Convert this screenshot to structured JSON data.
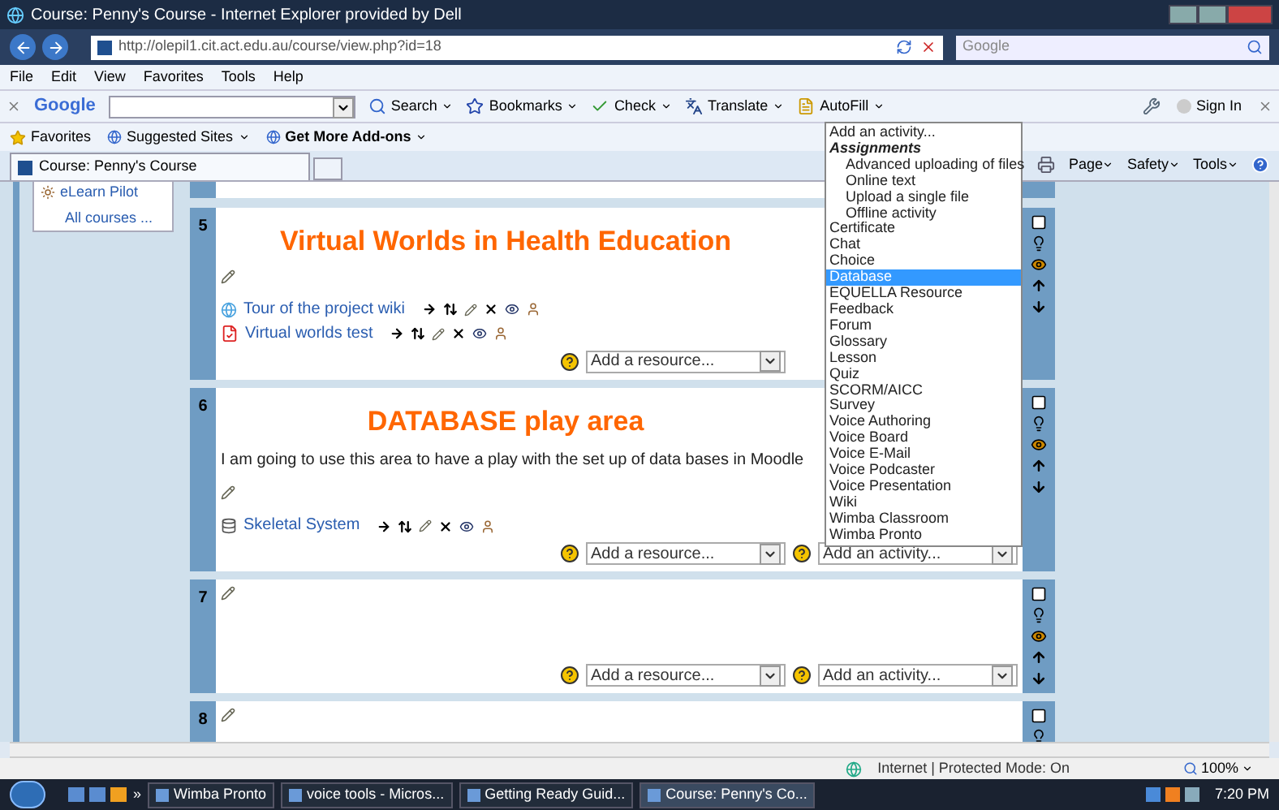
{
  "window": {
    "title": "Course: Penny's Course - Internet Explorer provided by Dell"
  },
  "address_bar": {
    "url": "http://olepil1.cit.act.edu.au/course/view.php?id=18",
    "search_placeholder": "Google"
  },
  "menu": [
    "File",
    "Edit",
    "View",
    "Favorites",
    "Tools",
    "Help"
  ],
  "google_toolbar": {
    "brand": "Google",
    "buttons": [
      {
        "label": "Search",
        "kind": "search"
      },
      {
        "label": "Bookmarks",
        "kind": "star"
      },
      {
        "label": "Check",
        "kind": "check"
      },
      {
        "label": "Translate",
        "kind": "translate"
      },
      {
        "label": "AutoFill",
        "kind": "autofill"
      }
    ],
    "sign_in": "Sign In"
  },
  "favorites_bar": {
    "favorites": "Favorites",
    "links": [
      {
        "label": "Suggested Sites",
        "bold": false
      },
      {
        "label": "Get More Add-ons",
        "bold": true
      }
    ]
  },
  "tabs": [
    {
      "label": "Course: Penny's Course",
      "selected": true
    }
  ],
  "command_bar": [
    "Page",
    "Safety",
    "Tools"
  ],
  "sidebar": {
    "course": "eLearn Pilot",
    "all_courses": "All courses ..."
  },
  "sections": [
    {
      "number": "5",
      "title": "Virtual Worlds in Health Education",
      "activities": [
        {
          "name": "Tour of the project wiki",
          "kind": "wiki"
        },
        {
          "name": "Virtual worlds test",
          "kind": "quiz"
        }
      ],
      "add_resource": "Add a resource..."
    },
    {
      "number": "6",
      "title": "DATABASE play area",
      "summary": "I am going to use this area to have a play with the set up of data bases in Moodle",
      "activities": [
        {
          "name": "Skeletal System",
          "kind": "database"
        }
      ],
      "add_resource": "Add a resource...",
      "add_activity": "Add an activity..."
    },
    {
      "number": "7",
      "add_resource": "Add a resource...",
      "add_activity": "Add an activity..."
    },
    {
      "number": "8"
    }
  ],
  "activity_dropdown": {
    "options": [
      {
        "label": "Add an activity...",
        "kind": "option",
        "selected": false
      },
      {
        "label": "Assignments",
        "kind": "group",
        "selected": false
      },
      {
        "label": "Advanced uploading of files",
        "kind": "suboption",
        "selected": false
      },
      {
        "label": "Online text",
        "kind": "suboption",
        "selected": false
      },
      {
        "label": "Upload a single file",
        "kind": "suboption",
        "selected": false
      },
      {
        "label": "Offline activity",
        "kind": "suboption",
        "selected": false
      },
      {
        "label": "Certificate",
        "kind": "option",
        "selected": false
      },
      {
        "label": "Chat",
        "kind": "option",
        "selected": false
      },
      {
        "label": "Choice",
        "kind": "option",
        "selected": false
      },
      {
        "label": "Database",
        "kind": "option",
        "selected": true
      },
      {
        "label": "EQUELLA Resource",
        "kind": "option",
        "selected": false
      },
      {
        "label": "Feedback",
        "kind": "option",
        "selected": false
      },
      {
        "label": "Forum",
        "kind": "option",
        "selected": false
      },
      {
        "label": "Glossary",
        "kind": "option",
        "selected": false
      },
      {
        "label": "Lesson",
        "kind": "option",
        "selected": false
      },
      {
        "label": "Quiz",
        "kind": "option",
        "selected": false
      },
      {
        "label": "SCORM/AICC",
        "kind": "option",
        "selected": false
      },
      {
        "label": "Survey",
        "kind": "option",
        "selected": false
      },
      {
        "label": "Voice Authoring",
        "kind": "option",
        "selected": false
      },
      {
        "label": "Voice Board",
        "kind": "option",
        "selected": false
      },
      {
        "label": "Voice E-Mail",
        "kind": "option",
        "selected": false
      },
      {
        "label": "Voice Podcaster",
        "kind": "option",
        "selected": false
      },
      {
        "label": "Voice Presentation",
        "kind": "option",
        "selected": false
      },
      {
        "label": "Wiki",
        "kind": "option",
        "selected": false
      },
      {
        "label": "Wimba Classroom",
        "kind": "option",
        "selected": false
      },
      {
        "label": "Wimba Pronto",
        "kind": "option",
        "selected": false
      }
    ]
  },
  "status_bar": {
    "zone": "Internet | Protected Mode: On",
    "zoom": "100%"
  },
  "taskbar": {
    "items": [
      {
        "label": "Wimba Pronto",
        "selected": false
      },
      {
        "label": "voice tools - Micros...",
        "selected": false
      },
      {
        "label": "Getting Ready Guid...",
        "selected": false
      },
      {
        "label": "Course: Penny's Co...",
        "selected": true
      }
    ],
    "overflow": "»",
    "clock": "7:20 PM"
  }
}
